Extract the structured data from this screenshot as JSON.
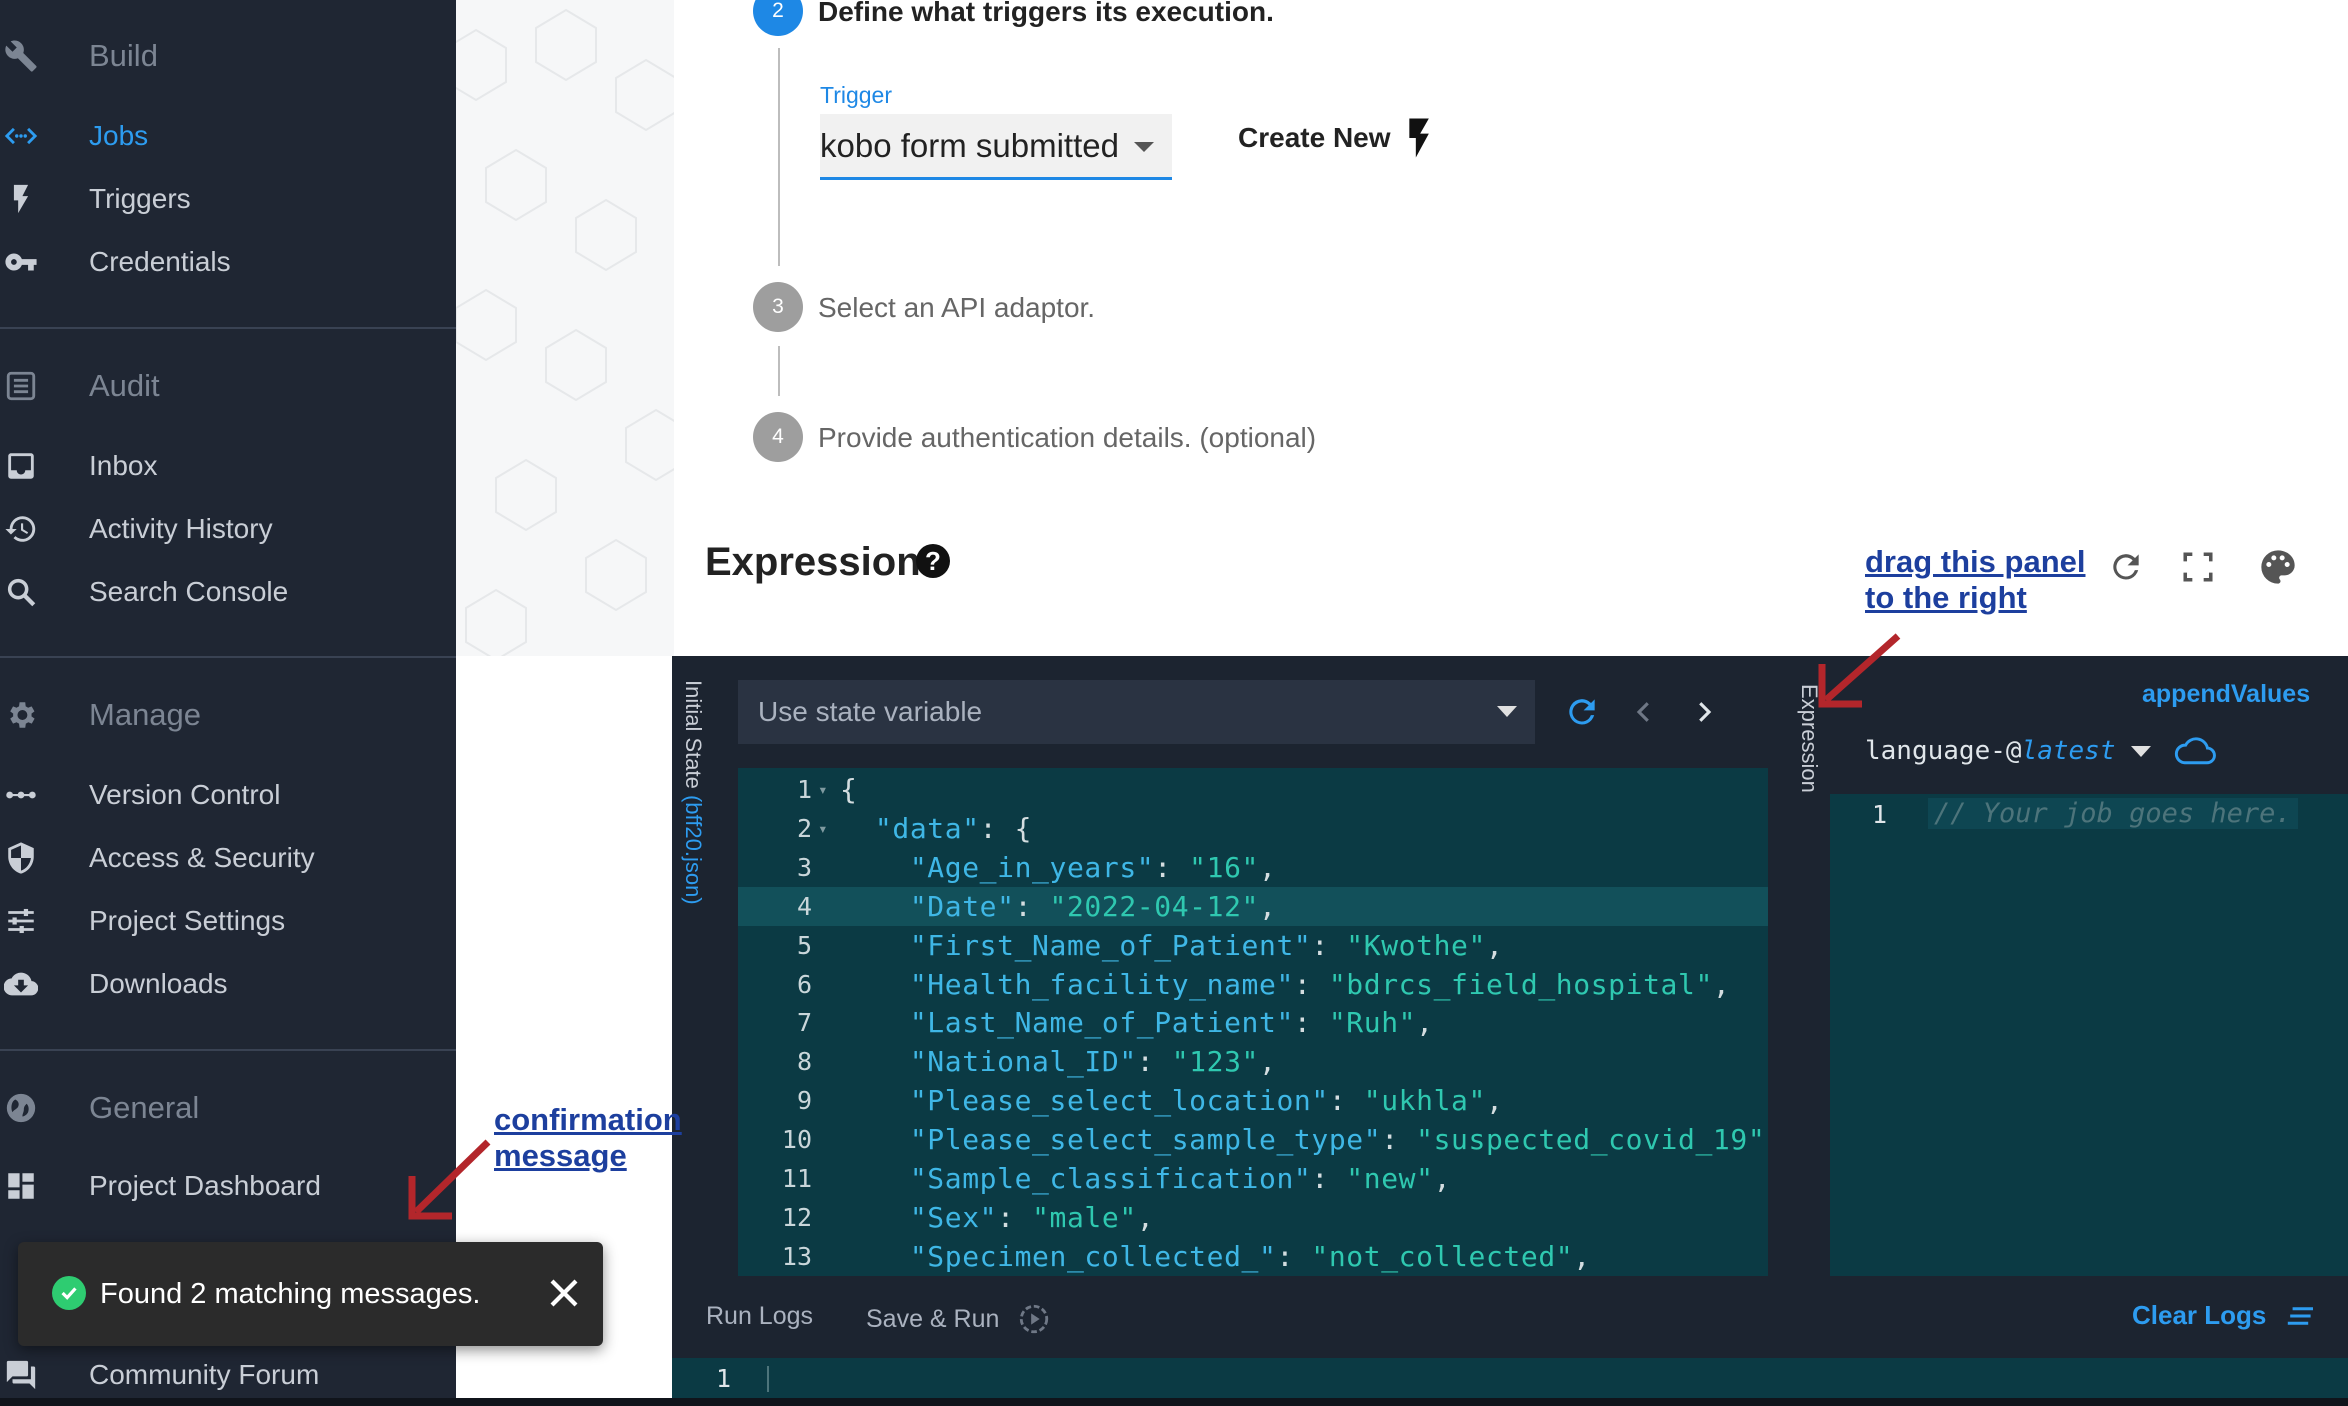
{
  "sidebar": {
    "build": {
      "header": "Build",
      "items": [
        {
          "label": "Jobs",
          "active": true,
          "icon": "code-brackets-icon"
        },
        {
          "label": "Triggers",
          "icon": "bolt-icon"
        },
        {
          "label": "Credentials",
          "icon": "key-icon"
        }
      ]
    },
    "audit": {
      "header": "Audit",
      "items": [
        {
          "label": "Inbox",
          "icon": "inbox-icon"
        },
        {
          "label": "Activity History",
          "icon": "history-icon"
        },
        {
          "label": "Search Console",
          "icon": "search-icon"
        }
      ]
    },
    "manage": {
      "header": "Manage",
      "items": [
        {
          "label": "Version Control",
          "icon": "dots-icon"
        },
        {
          "label": "Access & Security",
          "icon": "shield-icon"
        },
        {
          "label": "Project Settings",
          "icon": "sliders-icon"
        },
        {
          "label": "Downloads",
          "icon": "cloud-download-icon"
        }
      ]
    },
    "general": {
      "header": "General",
      "items": [
        {
          "label": "Project Dashboard",
          "icon": "dashboard-icon"
        },
        {
          "label": "Community Forum",
          "icon": "forum-icon"
        }
      ]
    }
  },
  "steps": [
    {
      "number": "2",
      "text": "Define what triggers its execution.",
      "active": true
    },
    {
      "number": "3",
      "text": "Select an API adaptor."
    },
    {
      "number": "4",
      "text": "Provide authentication details. (optional)"
    }
  ],
  "trigger": {
    "label": "Trigger",
    "value": "kobo form submitted",
    "create_new": "Create New"
  },
  "expression": {
    "title": "Expression",
    "help": "?"
  },
  "annotations": {
    "drag_panel": [
      "drag this panel",
      "to the right"
    ],
    "confirmation": [
      "confirmation",
      "message"
    ]
  },
  "editor": {
    "state_tab_label": "Initial State",
    "state_file": "(bff20.json)",
    "state_select": "Use state variable",
    "expression_tab_label": "Expression",
    "append_values": "appendValues",
    "adaptor_name": "language-@",
    "adaptor_version": "latest",
    "job_line_number": "1",
    "job_placeholder": "// Your job goes here.",
    "state_lines": [
      {
        "n": "1",
        "fold": true,
        "parts": [
          [
            "pun",
            "{"
          ]
        ]
      },
      {
        "n": "2",
        "fold": true,
        "parts": [
          [
            "pun",
            "  "
          ],
          [
            "key",
            "\"data\""
          ],
          [
            "pun",
            ": {"
          ]
        ]
      },
      {
        "n": "3",
        "parts": [
          [
            "pun",
            "    "
          ],
          [
            "key",
            "\"Age_in_years\""
          ],
          [
            "pun",
            ": "
          ],
          [
            "str",
            "\"16\""
          ],
          [
            "pun",
            ","
          ]
        ]
      },
      {
        "n": "4",
        "highlight": true,
        "parts": [
          [
            "pun",
            "    "
          ],
          [
            "key",
            "\"Date\""
          ],
          [
            "pun",
            ": "
          ],
          [
            "str",
            "\"2022-04-12\""
          ],
          [
            "pun",
            ","
          ]
        ]
      },
      {
        "n": "5",
        "parts": [
          [
            "pun",
            "    "
          ],
          [
            "key",
            "\"First_Name_of_Patient\""
          ],
          [
            "pun",
            ": "
          ],
          [
            "str",
            "\"Kwothe\""
          ],
          [
            "pun",
            ","
          ]
        ]
      },
      {
        "n": "6",
        "parts": [
          [
            "pun",
            "    "
          ],
          [
            "key",
            "\"Health_facility_name\""
          ],
          [
            "pun",
            ": "
          ],
          [
            "str",
            "\"bdrcs_field_hospital\""
          ],
          [
            "pun",
            ","
          ]
        ]
      },
      {
        "n": "7",
        "parts": [
          [
            "pun",
            "    "
          ],
          [
            "key",
            "\"Last_Name_of_Patient\""
          ],
          [
            "pun",
            ": "
          ],
          [
            "str",
            "\"Ruh\""
          ],
          [
            "pun",
            ","
          ]
        ]
      },
      {
        "n": "8",
        "parts": [
          [
            "pun",
            "    "
          ],
          [
            "key",
            "\"National_ID\""
          ],
          [
            "pun",
            ": "
          ],
          [
            "str",
            "\"123\""
          ],
          [
            "pun",
            ","
          ]
        ]
      },
      {
        "n": "9",
        "parts": [
          [
            "pun",
            "    "
          ],
          [
            "key",
            "\"Please_select_location\""
          ],
          [
            "pun",
            ": "
          ],
          [
            "str",
            "\"ukhla\""
          ],
          [
            "pun",
            ","
          ]
        ]
      },
      {
        "n": "10",
        "parts": [
          [
            "pun",
            "    "
          ],
          [
            "key",
            "\"Please_select_sample_type\""
          ],
          [
            "pun",
            ": "
          ],
          [
            "str",
            "\"suspected_covid_19\""
          ],
          [
            "pun",
            ","
          ]
        ]
      },
      {
        "n": "11",
        "parts": [
          [
            "pun",
            "    "
          ],
          [
            "key",
            "\"Sample_classification\""
          ],
          [
            "pun",
            ": "
          ],
          [
            "str",
            "\"new\""
          ],
          [
            "pun",
            ","
          ]
        ]
      },
      {
        "n": "12",
        "parts": [
          [
            "pun",
            "    "
          ],
          [
            "key",
            "\"Sex\""
          ],
          [
            "pun",
            ": "
          ],
          [
            "str",
            "\"male\""
          ],
          [
            "pun",
            ","
          ]
        ]
      },
      {
        "n": "13",
        "parts": [
          [
            "pun",
            "    "
          ],
          [
            "key",
            "\"Specimen_collected_\""
          ],
          [
            "pun",
            ": "
          ],
          [
            "str",
            "\"not_collected\""
          ],
          [
            "pun",
            ","
          ]
        ]
      }
    ]
  },
  "logs": {
    "run_logs": "Run Logs",
    "save_run": "Save & Run",
    "clear_logs": "Clear Logs",
    "line_number": "1"
  },
  "toast": {
    "message": "Found 2 matching messages."
  },
  "colors": {
    "sidebar_bg": "#1f2633",
    "accent": "#2d9cf0",
    "editor_bg": "#0b3a44",
    "annotation": "#1d3f9e",
    "arrow": "#b3262b",
    "toast_bg": "#2b2b2b",
    "success": "#2ecc71"
  }
}
